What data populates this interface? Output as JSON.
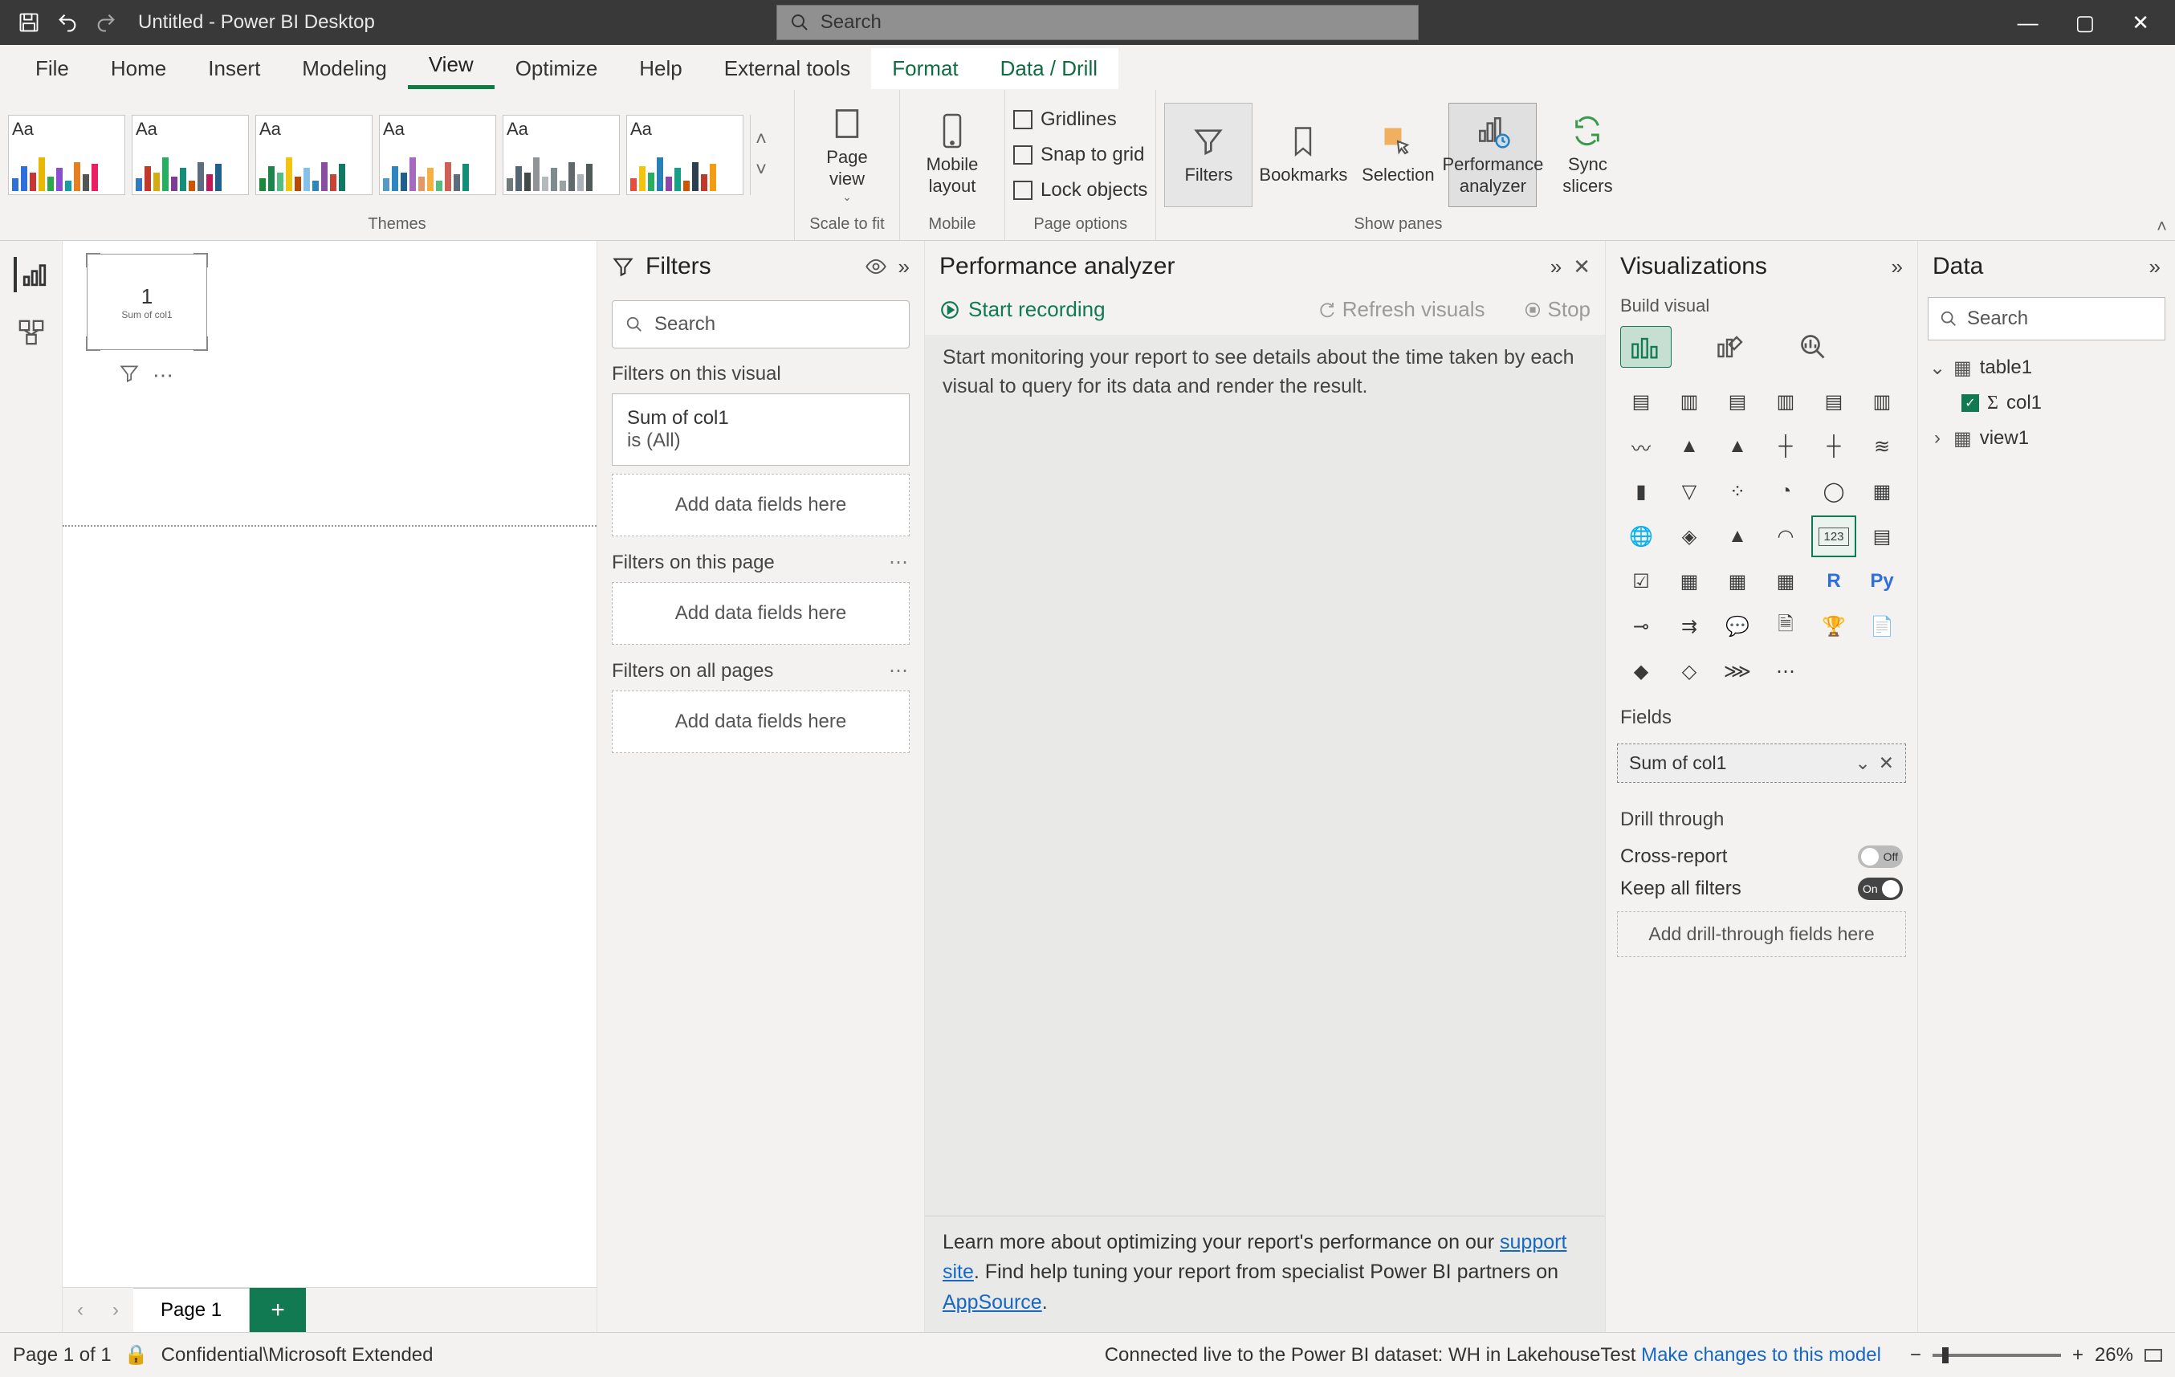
{
  "app": {
    "title": "Untitled - Power BI Desktop",
    "search_placeholder": "Search"
  },
  "menu": {
    "items": [
      "File",
      "Home",
      "Insert",
      "Modeling",
      "View",
      "Optimize",
      "Help",
      "External tools",
      "Format",
      "Data / Drill"
    ],
    "active": "View",
    "contextual": [
      "Format",
      "Data / Drill"
    ]
  },
  "ribbon": {
    "themes_label": "Themes",
    "scale_label": "Scale to fit",
    "mobile_label": "Mobile",
    "pageoptions_label": "Page options",
    "showpanes_label": "Show panes",
    "page_view": "Page\nview",
    "mobile_layout": "Mobile\nlayout",
    "gridlines": "Gridlines",
    "snap": "Snap to grid",
    "lock": "Lock objects",
    "filters_btn": "Filters",
    "bookmarks_btn": "Bookmarks",
    "selection_btn": "Selection",
    "perf_btn": "Performance\nanalyzer",
    "sync_btn": "Sync\nslicers"
  },
  "canvas": {
    "value": "1",
    "measure": "Sum of col1"
  },
  "filters": {
    "title": "Filters",
    "search_placeholder": "Search",
    "visual_section": "Filters on this visual",
    "visual_filter_name": "Sum of col1",
    "visual_filter_state": "is (All)",
    "drop_text": "Add data fields here",
    "page_section": "Filters on this page",
    "all_section": "Filters on all pages"
  },
  "perf": {
    "title": "Performance analyzer",
    "start": "Start recording",
    "refresh": "Refresh visuals",
    "stop": "Stop",
    "blurb": "Start monitoring your report to see details about the time taken by each visual to query for its data and render the result.",
    "foot1_pre": "Learn more about optimizing your report's performance on our ",
    "foot1_link": "support site",
    "foot1_post": ". Find help tuning your report from specialist Power BI partners on ",
    "foot2_link": "AppSource",
    "foot2_post": "."
  },
  "viz": {
    "title": "Visualizations",
    "subtitle": "Build visual",
    "fields_label": "Fields",
    "field_value": "Sum of col1",
    "drill_label": "Drill through",
    "cross": "Cross-report",
    "keep": "Keep all filters",
    "drill_drop": "Add drill-through fields here",
    "toggle_off": "Off",
    "toggle_on": "On",
    "r_label": "R",
    "py_label": "Py"
  },
  "data": {
    "title": "Data",
    "search_placeholder": "Search",
    "table": "table1",
    "col": "col1",
    "view": "view1"
  },
  "page_tabs": {
    "page1": "Page 1"
  },
  "status": {
    "page": "Page 1 of 1",
    "classification": "Confidential\\Microsoft Extended",
    "connection": "Connected live to the Power BI dataset: WH in LakehouseTest ",
    "changes_link": "Make changes to this model",
    "zoom": "26%"
  }
}
